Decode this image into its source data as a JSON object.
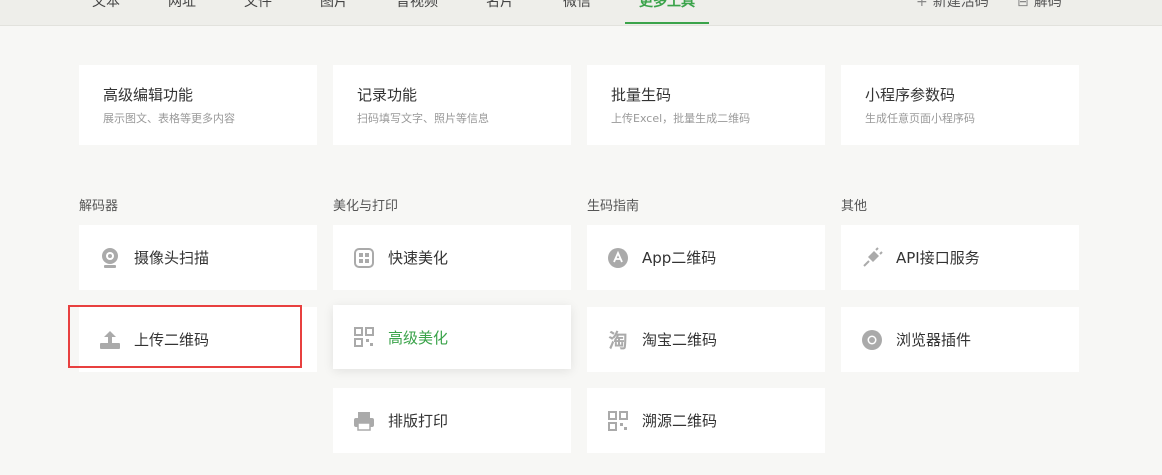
{
  "nav": {
    "tabs": [
      "文本",
      "网址",
      "文件",
      "图片",
      "音视频",
      "名片",
      "微信",
      "更多工具"
    ],
    "active_tab": "更多工具",
    "new_code_label": "新建活码",
    "decode_label": "解码"
  },
  "features": [
    {
      "title": "高级编辑功能",
      "desc": "展示图文、表格等更多内容"
    },
    {
      "title": "记录功能",
      "desc": "扫码填写文字、照片等信息"
    },
    {
      "title": "批量生码",
      "desc": "上传Excel，批量生成二维码"
    },
    {
      "title": "小程序参数码",
      "desc": "生成任意页面小程序码"
    }
  ],
  "sections": {
    "decoder": {
      "title": "解码器",
      "items": [
        "摄像头扫描",
        "上传二维码"
      ]
    },
    "beautify": {
      "title": "美化与打印",
      "items": [
        "快速美化",
        "高级美化",
        "排版打印"
      ]
    },
    "guide": {
      "title": "生码指南",
      "items": [
        "App二维码",
        "淘宝二维码",
        "溯源二维码"
      ]
    },
    "other": {
      "title": "其他",
      "items": [
        "API接口服务",
        "浏览器插件"
      ]
    }
  },
  "colors": {
    "accent": "#3aa34a",
    "highlight": "#e8403f",
    "background": "#f7f7f5"
  }
}
